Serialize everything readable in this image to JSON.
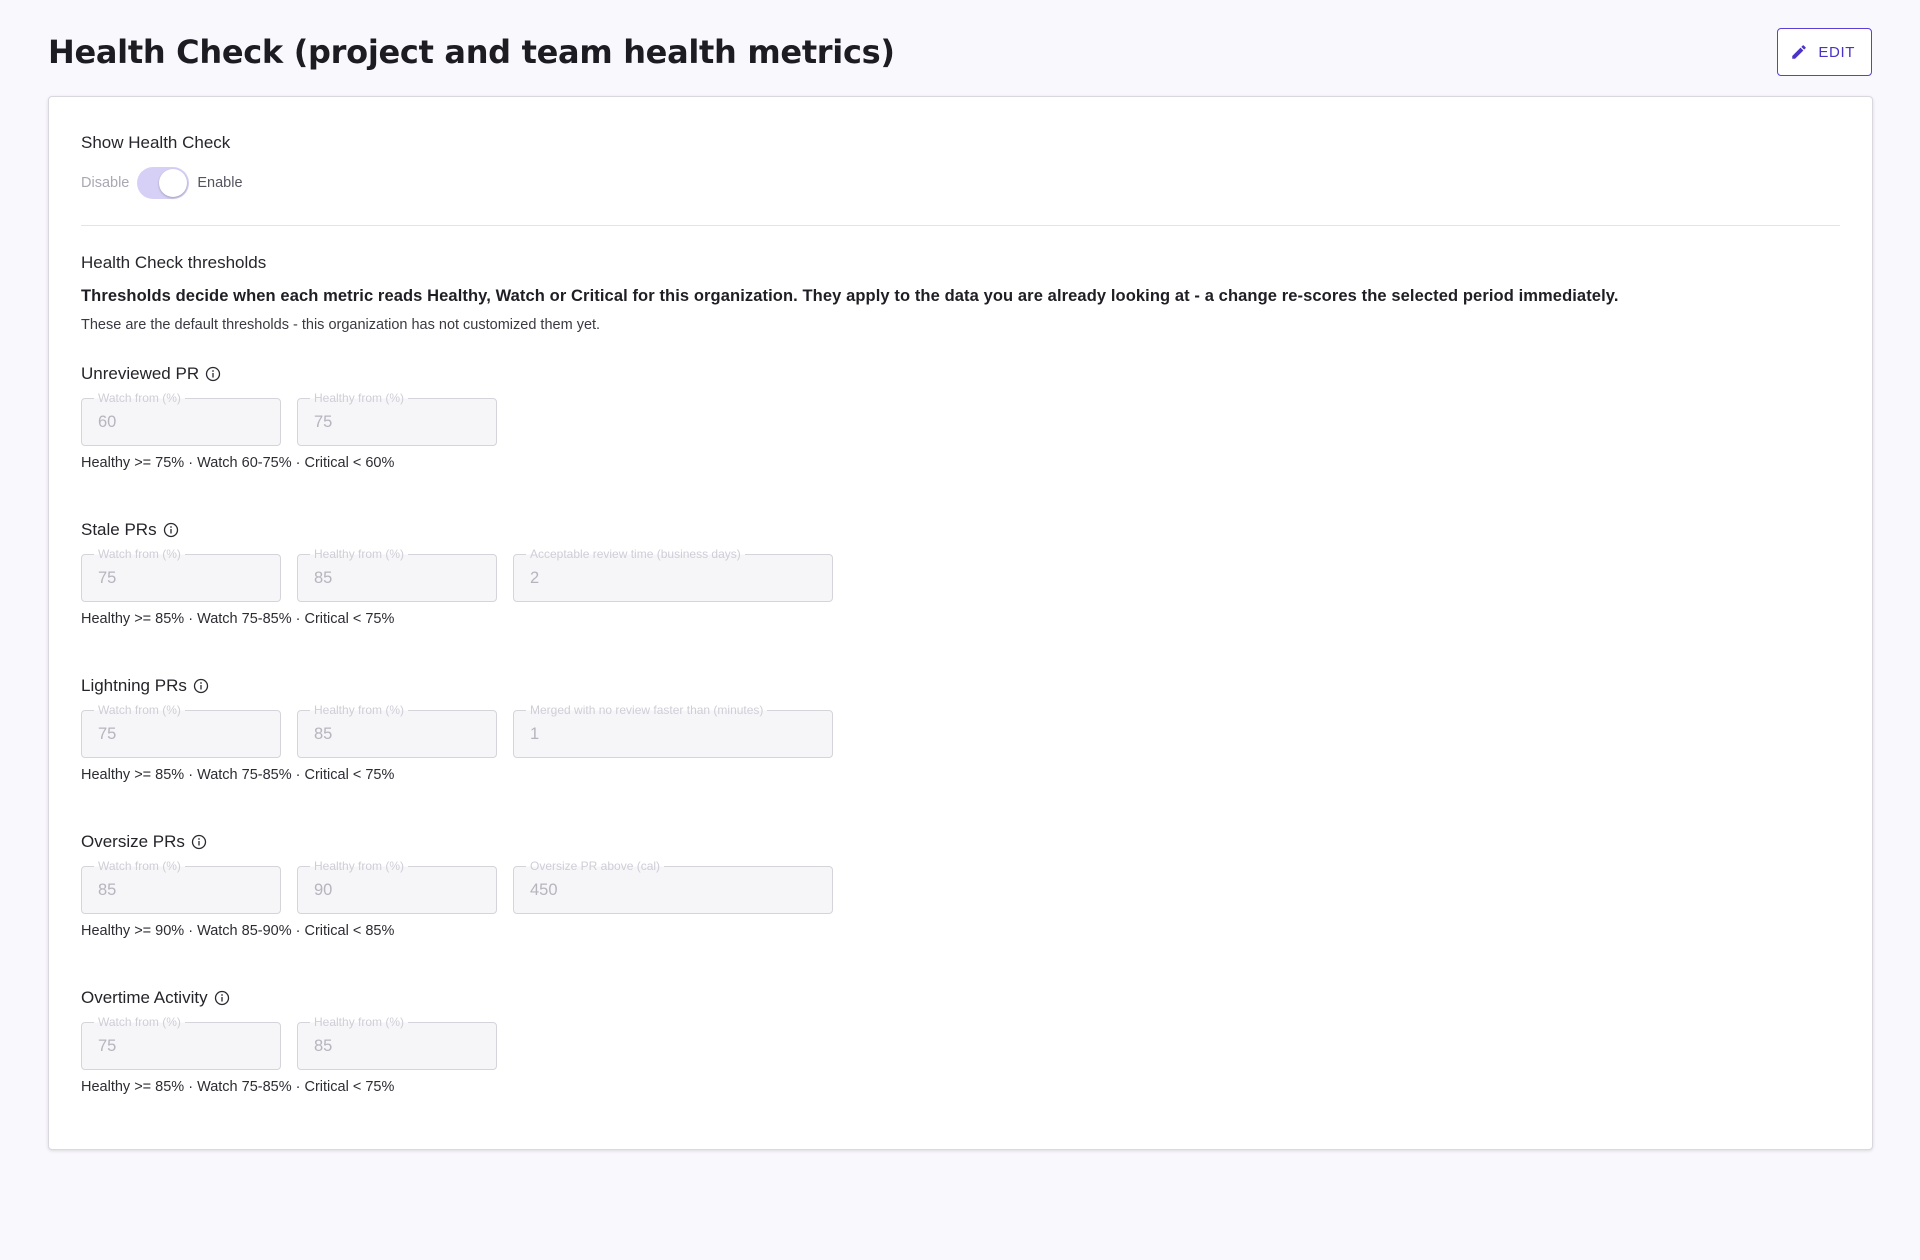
{
  "header": {
    "title": "Health Check (project and team health metrics)",
    "edit_label": "EDIT"
  },
  "show_health_check": {
    "label": "Show Health Check",
    "off_label": "Disable",
    "on_label": "Enable",
    "enabled": true
  },
  "thresholds": {
    "heading": "Health Check thresholds",
    "description": "Thresholds decide when each metric reads Healthy, Watch or Critical for this organization. They apply to the data you are already looking at - a change re-scores the selected period immediately.",
    "note": "These are the default thresholds - this organization has not customized them yet."
  },
  "metrics": [
    {
      "title": "Unreviewed PR",
      "fields": [
        {
          "label": "Watch from (%)",
          "value": "60"
        },
        {
          "label": "Healthy from (%)",
          "value": "75"
        }
      ],
      "summary": "Healthy >= 75% · Watch 60-75% · Critical < 60%"
    },
    {
      "title": "Stale PRs",
      "fields": [
        {
          "label": "Watch from (%)",
          "value": "75"
        },
        {
          "label": "Healthy from (%)",
          "value": "85"
        },
        {
          "label": "Acceptable review time (business days)",
          "value": "2"
        }
      ],
      "summary": "Healthy >= 85% · Watch 75-85% · Critical < 75%"
    },
    {
      "title": "Lightning PRs",
      "fields": [
        {
          "label": "Watch from (%)",
          "value": "75"
        },
        {
          "label": "Healthy from (%)",
          "value": "85"
        },
        {
          "label": "Merged with no review faster than (minutes)",
          "value": "1"
        }
      ],
      "summary": "Healthy >= 85% · Watch 75-85% · Critical < 75%"
    },
    {
      "title": "Oversize PRs",
      "fields": [
        {
          "label": "Watch from (%)",
          "value": "85"
        },
        {
          "label": "Healthy from (%)",
          "value": "90"
        },
        {
          "label": "Oversize PR above (cal)",
          "value": "450"
        }
      ],
      "summary": "Healthy >= 90% · Watch 85-90% · Critical < 85%"
    },
    {
      "title": "Overtime Activity",
      "fields": [
        {
          "label": "Watch from (%)",
          "value": "75"
        },
        {
          "label": "Healthy from (%)",
          "value": "85"
        }
      ],
      "summary": "Healthy >= 85% · Watch 75-85% · Critical < 75%"
    }
  ],
  "colors": {
    "accent": "#5b3fd9",
    "toggle_track": "#d7d0f6",
    "page_bg": "#f9f8fd"
  }
}
